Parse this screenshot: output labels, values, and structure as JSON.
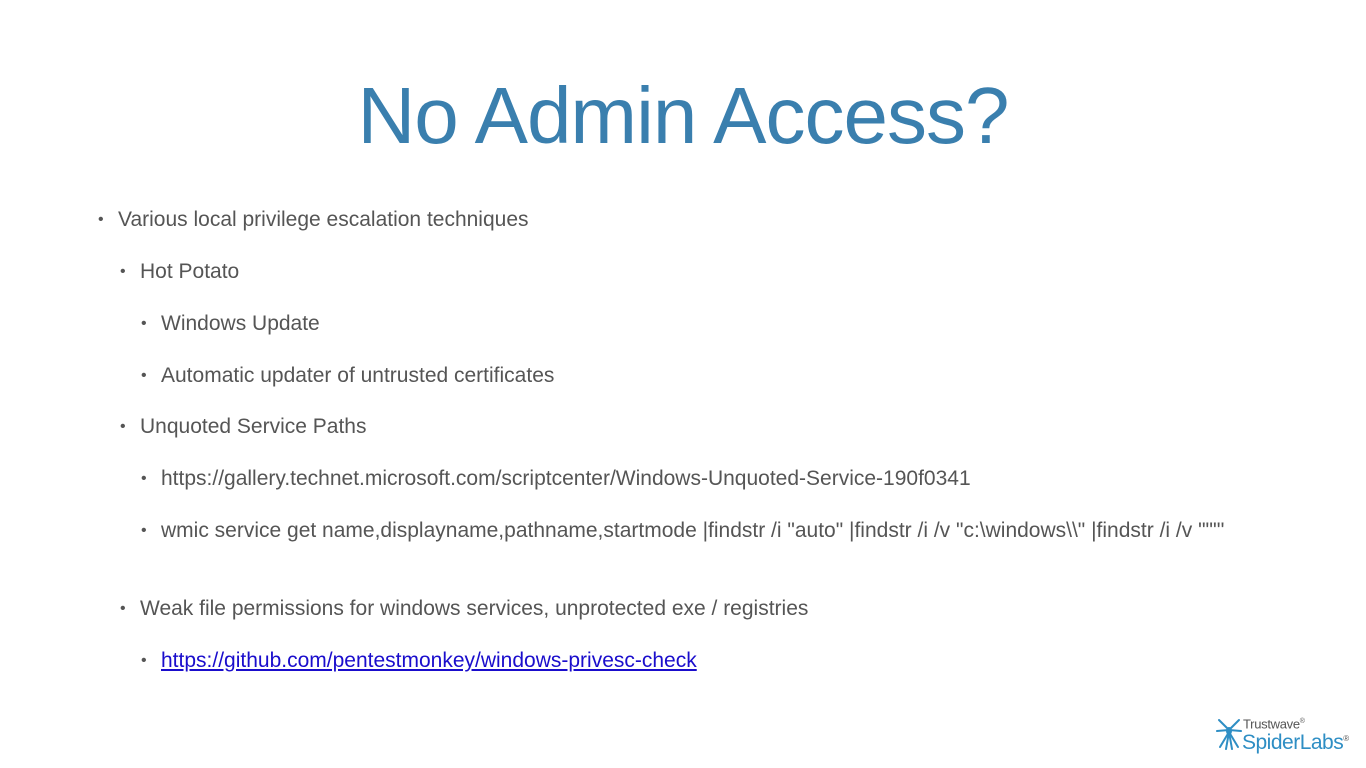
{
  "slide": {
    "title": "No Admin Access?",
    "bullets": [
      {
        "level": 1,
        "text": "Various local privilege escalation techniques"
      },
      {
        "level": 2,
        "text": "Hot Potato"
      },
      {
        "level": 3,
        "text": "Windows Update"
      },
      {
        "level": 3,
        "text": "Automatic updater of untrusted certificates"
      },
      {
        "level": 2,
        "text": "Unquoted Service Paths"
      },
      {
        "level": 3,
        "text": "https://gallery.technet.microsoft.com/scriptcenter/Windows-Unquoted-Service-190f0341"
      },
      {
        "level": 3,
        "text": "wmic service get name,displayname,pathname,startmode |findstr /i \"auto\" |findstr /i /v \"c:\\windows\\\\\" |findstr /i /v \"\"\"'"
      },
      {
        "level": 2,
        "text": "Weak file permissions for windows services, unprotected exe / registries"
      },
      {
        "level": 3,
        "text": "https://github.com/pentestmonkey/windows-privesc-check",
        "link": true
      }
    ],
    "bullet_glyph": "•"
  },
  "logo": {
    "top_text": "Trustwave",
    "top_mark": "®",
    "bottom_text": "SpiderLabs",
    "bottom_mark": "®",
    "icon": "spider-icon",
    "colors": {
      "brand_blue": "#2e8ec4",
      "text_gray": "#555555"
    }
  },
  "colors": {
    "title": "#3a7fae",
    "body_text": "#555555",
    "link": "#1a0dcc",
    "background": "#ffffff"
  }
}
